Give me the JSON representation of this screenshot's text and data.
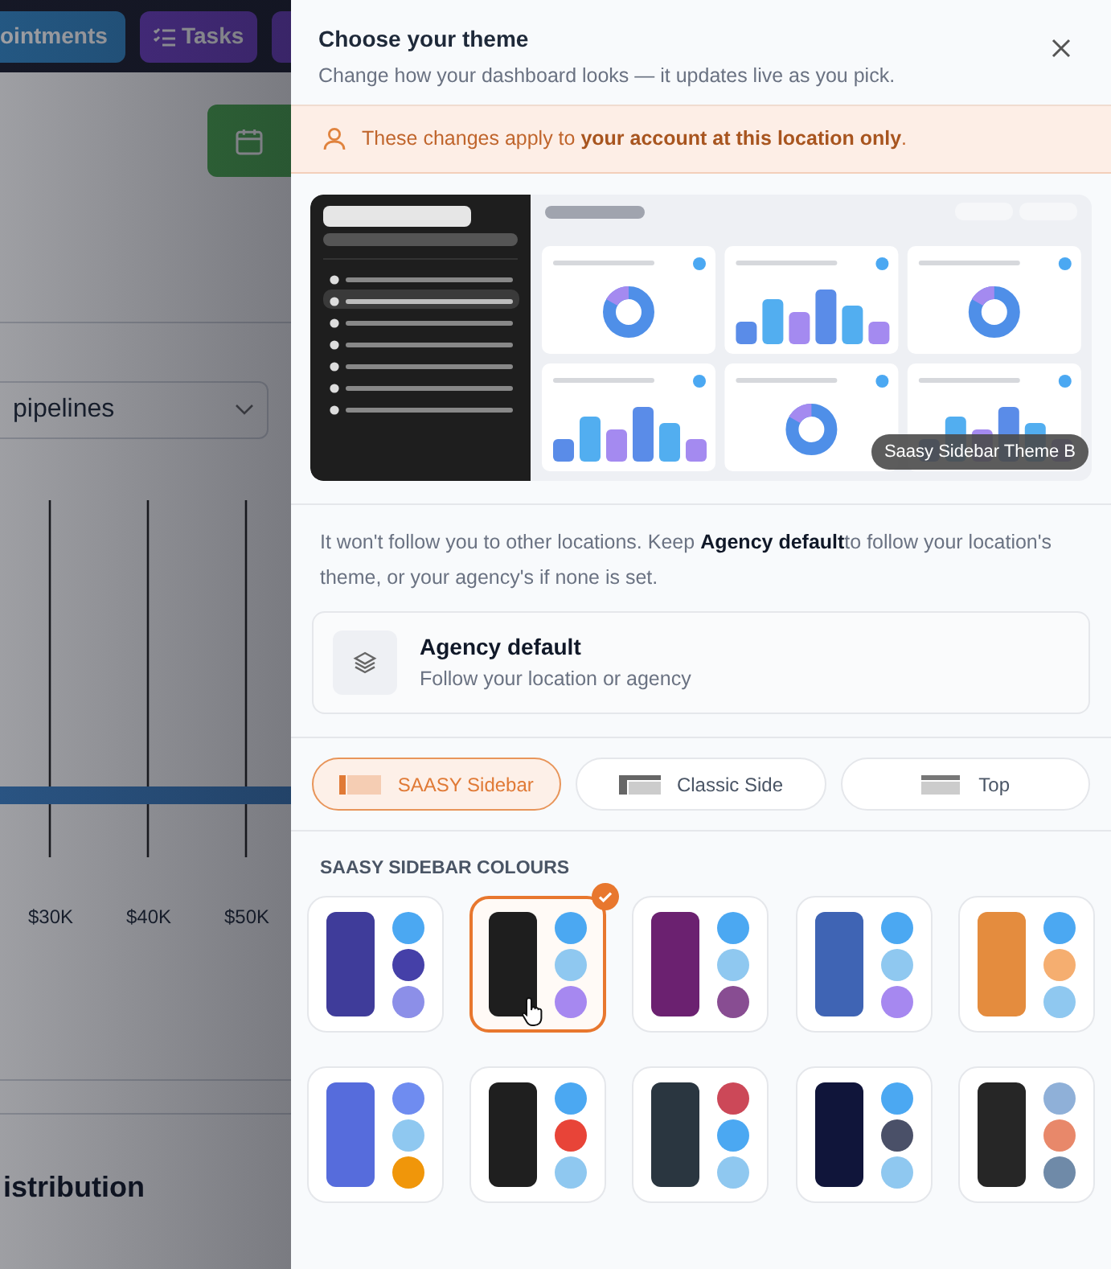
{
  "background": {
    "toolbar_buttons": [
      {
        "label": "ointments",
        "kind": "plain"
      },
      {
        "label": "Tasks",
        "kind": "tasks"
      }
    ],
    "dropdown": {
      "value": "pipelines"
    },
    "axis_labels": [
      "$30K",
      "$40K",
      "$50K"
    ],
    "section_title": "istribution"
  },
  "panel": {
    "title": "Choose your theme",
    "subtitle": "Change how your dashboard looks — it updates live as you pick.",
    "notice": "These changes apply to **your account at this location only**.",
    "preview_label": "Saasy Sidebar Theme B",
    "info": "It won't follow you to other locations. Keep **Agency default**to follow your location's theme, or your agency's if none is set.",
    "agency_option": {
      "title": "Agency default",
      "subtitle": "Follow your location or agency"
    },
    "layouts": [
      {
        "label": "SAASY Sidebar",
        "kind": "saasy",
        "selected": true
      },
      {
        "label": "Classic Side",
        "kind": "classic",
        "selected": false
      },
      {
        "label": "Top",
        "kind": "top",
        "selected": false
      }
    ],
    "colours_heading": "SAASY SIDEBAR COLOURS",
    "swatches": [
      {
        "selected": false,
        "color": "#3f3c9a",
        "dots": [
          {
            "color": "#4ba8f2"
          },
          {
            "color": "#4540a8"
          },
          {
            "color": "#8c8fe8"
          }
        ]
      },
      {
        "selected": true,
        "color": "#1e1e1e",
        "dots": [
          {
            "color": "#4ba8f2"
          },
          {
            "color": "#8fc8f0"
          },
          {
            "color": "#a688f0"
          }
        ]
      },
      {
        "selected": false,
        "color": "#6b2170",
        "dots": [
          {
            "color": "#4ba8f2"
          },
          {
            "color": "#8fc8f0"
          },
          {
            "color": "#884d92"
          }
        ]
      },
      {
        "selected": false,
        "color": "#3f64b4",
        "dots": [
          {
            "color": "#4ba8f2"
          },
          {
            "color": "#8fc8f0"
          },
          {
            "color": "#a688f0"
          }
        ]
      },
      {
        "selected": false,
        "color": "#e48c3e",
        "dots": [
          {
            "color": "#4ba8f2"
          },
          {
            "color": "#f5ae70"
          },
          {
            "color": "#8fc8f0"
          }
        ]
      },
      {
        "selected": false,
        "color": "#566cdc",
        "dots": [
          {
            "color": "#6f8cf0"
          },
          {
            "color": "#8fc8f0"
          },
          {
            "color": "#f0960a"
          }
        ]
      },
      {
        "selected": false,
        "color": "#1f1f1f",
        "dots": [
          {
            "color": "#4ba8f2"
          },
          {
            "color": "#e84438"
          },
          {
            "color": "#8fc8f0"
          }
        ]
      },
      {
        "selected": false,
        "color": "#2a3640",
        "dots": [
          {
            "color": "#cc4858"
          },
          {
            "color": "#4ba8f2"
          },
          {
            "color": "#8fc8f0"
          }
        ]
      },
      {
        "selected": false,
        "color": "#10153a",
        "dots": [
          {
            "color": "#4ba8f2"
          },
          {
            "color": "#4a5068"
          },
          {
            "color": "#8fc8f0"
          }
        ]
      },
      {
        "selected": false,
        "color": "#262626",
        "dots": [
          {
            "color": "#8fb0d8"
          },
          {
            "color": "#e8886a"
          },
          {
            "color": "#6f8aa8"
          }
        ]
      }
    ]
  }
}
